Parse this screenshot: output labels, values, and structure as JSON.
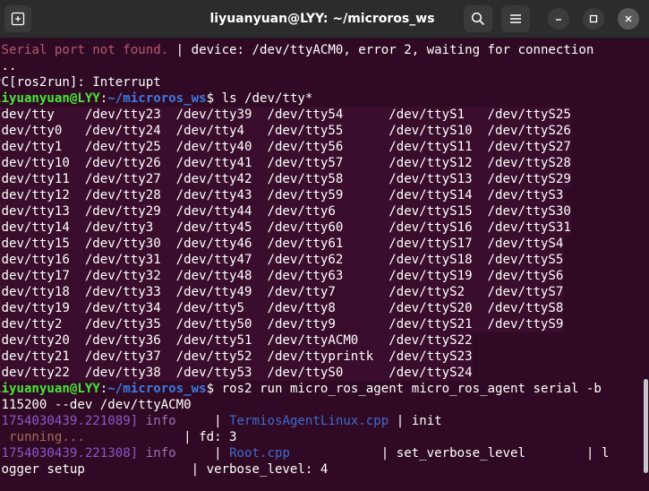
{
  "window": {
    "title": "liyuanyuan@LYY: ~/microros_ws"
  },
  "icons": {
    "new_tab": "new-tab-icon",
    "search": "search-icon",
    "menu": "hamburger-menu-icon",
    "minimize": "minimize-icon",
    "maximize": "maximize-icon",
    "close": "close-icon"
  },
  "terminal": {
    "line0": {
      "a": " Serial port not found.",
      "b": " | device: /dev/ttyACM0, error 2, waiting for connection"
    },
    "line1": " ..",
    "line2": "^C[ros2run]: Interrupt",
    "prompt1": {
      "user": "liyuanyuan@LYY",
      "sep": ":",
      "path": "~/microros_ws",
      "cmd": "$ ls /dev/tty*"
    },
    "devices": [
      "/dev/tty    /dev/tty23  /dev/tty39  /dev/tty54      /dev/ttyS1   /dev/ttyS25",
      "/dev/tty0   /dev/tty24  /dev/tty4   /dev/tty55      /dev/ttyS10  /dev/ttyS26",
      "/dev/tty1   /dev/tty25  /dev/tty40  /dev/tty56      /dev/ttyS11  /dev/ttyS27",
      "/dev/tty10  /dev/tty26  /dev/tty41  /dev/tty57      /dev/ttyS12  /dev/ttyS28",
      "/dev/tty11  /dev/tty27  /dev/tty42  /dev/tty58      /dev/ttyS13  /dev/ttyS29",
      "/dev/tty12  /dev/tty28  /dev/tty43  /dev/tty59      /dev/ttyS14  /dev/ttyS3",
      "/dev/tty13  /dev/tty29  /dev/tty44  /dev/tty6       /dev/ttyS15  /dev/ttyS30",
      "/dev/tty14  /dev/tty3   /dev/tty45  /dev/tty60      /dev/ttyS16  /dev/ttyS31",
      "/dev/tty15  /dev/tty30  /dev/tty46  /dev/tty61      /dev/ttyS17  /dev/ttyS4",
      "/dev/tty16  /dev/tty31  /dev/tty47  /dev/tty62      /dev/ttyS18  /dev/ttyS5",
      "/dev/tty17  /dev/tty32  /dev/tty48  /dev/tty63      /dev/ttyS19  /dev/ttyS6",
      "/dev/tty18  /dev/tty33  /dev/tty49  /dev/tty7       /dev/ttyS2   /dev/ttyS7",
      "/dev/tty19  /dev/tty34  /dev/tty5   /dev/tty8       /dev/ttyS20  /dev/ttyS8",
      "/dev/tty2   /dev/tty35  /dev/tty50  /dev/tty9       /dev/ttyS21  /dev/ttyS9",
      "/dev/tty20  /dev/tty36  /dev/tty51  /dev/ttyACM0    /dev/ttyS22",
      "/dev/tty21  /dev/tty37  /dev/tty52  /dev/ttyprintk  /dev/ttyS23",
      "/dev/tty22  /dev/tty38  /dev/tty53  /dev/ttyS0      /dev/ttyS24"
    ],
    "prompt2": {
      "user": "liyuanyuan@LYY",
      "sep": ":",
      "path": "~/microros_ws",
      "cmd": "$ ros2 run micro_ros_agent micro_ros_agent serial -b"
    },
    "line_baud": " 115200 --dev /dev/ttyACM0",
    "log1": {
      "ts": "[1754030439.221089]",
      "level": " info     ",
      "bar": "| ",
      "file": "TermiosAgentLinux.cpp",
      "msg": " | init"
    },
    "log1b": {
      "state": "  running...",
      "rest": "             | fd: 3"
    },
    "log2": {
      "ts": "[1754030439.221308]",
      "level": " info     ",
      "bar": "| ",
      "file": "Root.cpp",
      "msg": "            | set_verbose_level        | l"
    },
    "log2b": " ogger setup              | verbose_level: 4"
  }
}
